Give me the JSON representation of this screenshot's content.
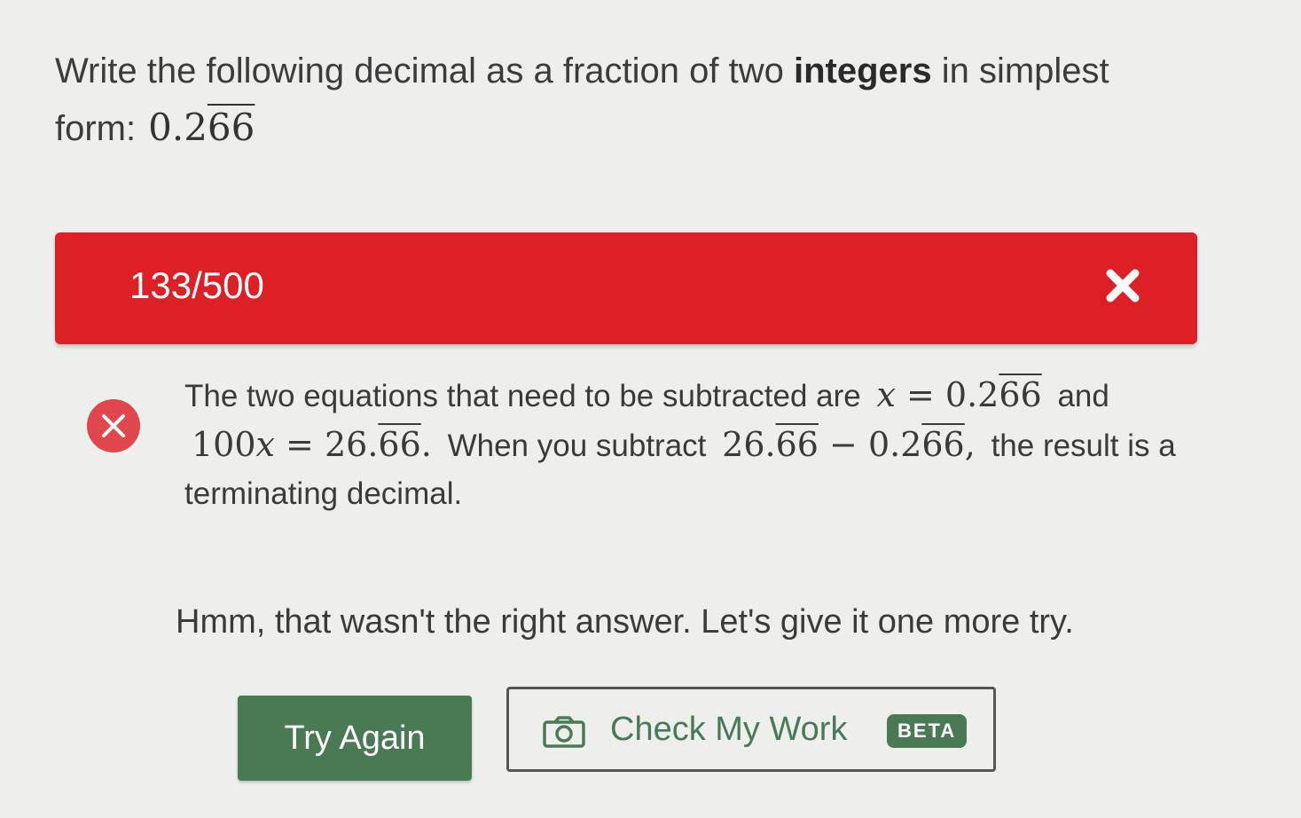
{
  "question": {
    "prefix": "Write the following decimal as a fraction of two ",
    "emphasis": "integers",
    "suffix": " in simplest form:",
    "decimal_whole": "0.2",
    "decimal_repeat": "66"
  },
  "answer": {
    "value": "133/500",
    "status_icon": "x-mark-icon",
    "bar_color": "#dd1f26"
  },
  "feedback": {
    "icon": "x-circle-icon",
    "text_1": "The two equations that need to be subtracted are",
    "eq1_lhs": "x",
    "eq1_eq": " = ",
    "eq1_whole": "0.2",
    "eq1_repeat": "66",
    "text_2": "and",
    "eq2_lhs_num": "100",
    "eq2_lhs_var": "x",
    "eq2_eq": " = ",
    "eq2_whole": "26.",
    "eq2_repeat": "66",
    "eq2_end": ".",
    "text_3": "When you subtract",
    "sub_a_whole": "26.",
    "sub_a_repeat": "66",
    "sub_op": " − ",
    "sub_b_whole": "0.2",
    "sub_b_repeat": "66",
    "sub_end": ",",
    "text_4": "the result is a terminating decimal."
  },
  "retry_message": "Hmm, that wasn't the right answer. Let's give it one more try.",
  "buttons": {
    "try_again": "Try Again",
    "check_work": "Check My Work",
    "check_work_icon": "camera-icon",
    "beta_badge": "BETA"
  },
  "colors": {
    "error_red": "#dd1f26",
    "icon_red": "#e0474c",
    "brand_green": "#4a7a54"
  }
}
